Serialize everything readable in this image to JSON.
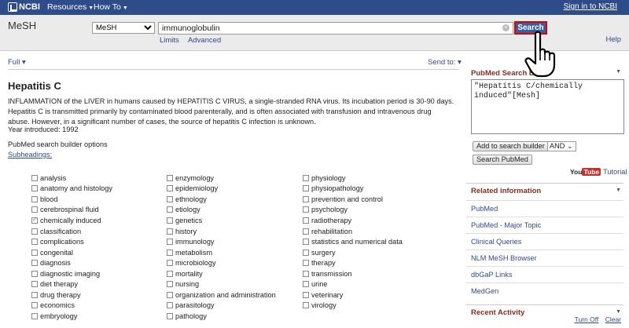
{
  "topbar": {
    "logo": "NCBI",
    "resources": "Resources",
    "howto": "How To",
    "signin": "Sign in to NCBI"
  },
  "search": {
    "database": "MeSH",
    "db_selected": "MeSH",
    "query": "immunoglobulin",
    "button": "Search",
    "limits": "Limits",
    "advanced": "Advanced",
    "help": "Help"
  },
  "main": {
    "full": "Full",
    "sendto": "Send to:",
    "title": "Hepatitis C",
    "description": "INFLAMMATION of the LIVER in humans caused by HEPATITIS C VIRUS, a single-stranded RNA virus. Its incubation period is 30-90 days. Hepatitis C is transmitted primarily by contaminated blood parenterally, and is often associated with transfusion and intravenous drug abuse. However, in a significant number of cases, the source of hepatitis C infection is unknown.",
    "year": "Year introduced: 1992",
    "builder_title": "PubMed search builder options",
    "subheadings": "Subheadings:"
  },
  "subheadings": {
    "col1": [
      {
        "label": "analysis",
        "checked": false
      },
      {
        "label": "anatomy and histology",
        "checked": false
      },
      {
        "label": "blood",
        "checked": false
      },
      {
        "label": "cerebrospinal fluid",
        "checked": false
      },
      {
        "label": "chemically induced",
        "checked": true
      },
      {
        "label": "classification",
        "checked": false
      },
      {
        "label": "complications",
        "checked": false
      },
      {
        "label": "congenital",
        "checked": false
      },
      {
        "label": "diagnosis",
        "checked": false
      },
      {
        "label": "diagnostic imaging",
        "checked": false
      },
      {
        "label": "diet therapy",
        "checked": false
      },
      {
        "label": "drug therapy",
        "checked": false
      },
      {
        "label": "economics",
        "checked": false
      },
      {
        "label": "embryology",
        "checked": false
      }
    ],
    "col2": [
      {
        "label": "enzymology",
        "checked": false
      },
      {
        "label": "epidemiology",
        "checked": false
      },
      {
        "label": "ethnology",
        "checked": false
      },
      {
        "label": "etiology",
        "checked": false
      },
      {
        "label": "genetics",
        "checked": false
      },
      {
        "label": "history",
        "checked": false
      },
      {
        "label": "immunology",
        "checked": false
      },
      {
        "label": "metabolism",
        "checked": false
      },
      {
        "label": "microbiology",
        "checked": false
      },
      {
        "label": "mortality",
        "checked": false
      },
      {
        "label": "nursing",
        "checked": false
      },
      {
        "label": "organization and administration",
        "checked": false
      },
      {
        "label": "parasitology",
        "checked": false
      },
      {
        "label": "pathology",
        "checked": false
      }
    ],
    "col3": [
      {
        "label": "physiology",
        "checked": false
      },
      {
        "label": "physiopathology",
        "checked": false
      },
      {
        "label": "prevention and control",
        "checked": false
      },
      {
        "label": "psychology",
        "checked": false
      },
      {
        "label": "radiotherapy",
        "checked": false
      },
      {
        "label": "rehabilitation",
        "checked": false
      },
      {
        "label": "statistics and numerical data",
        "checked": false
      },
      {
        "label": "surgery",
        "checked": false
      },
      {
        "label": "therapy",
        "checked": false
      },
      {
        "label": "transmission",
        "checked": false
      },
      {
        "label": "urine",
        "checked": false
      },
      {
        "label": "veterinary",
        "checked": false
      },
      {
        "label": "virology",
        "checked": false
      }
    ]
  },
  "sidebar": {
    "pb_title": "PubMed Search B",
    "pb_query": "\"Hepatitis C/chemically induced\"[Mesh]",
    "add_button": "Add to search builder",
    "operator": "AND",
    "search_pubmed": "Search PubMed",
    "youtube_you": "You",
    "youtube_tube": "Tube",
    "tutorial": "Tutorial",
    "related_title": "Related information",
    "related": [
      "PubMed",
      "PubMed - Major Topic",
      "Clinical Queries",
      "NLM MeSH Browser",
      "dbGaP Links",
      "MedGen"
    ],
    "recent_title": "Recent Activity",
    "turn_off": "Turn Off",
    "clear": "Clear"
  },
  "icons": {
    "cursor": "hand-pointer-icon"
  },
  "colors": {
    "topbar": "#2e4b8a",
    "search_button": "#3a5e9c",
    "highlight": "#e00000",
    "sidebar_header": "#8a2c1d"
  }
}
